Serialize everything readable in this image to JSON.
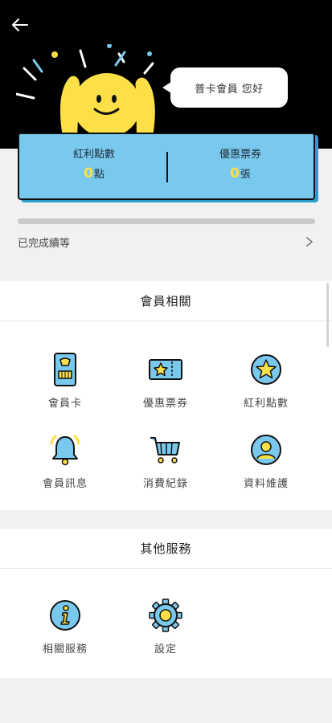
{
  "header": {
    "back_icon": "arrow-left-icon",
    "greeting": "普卡會員 您好"
  },
  "points": {
    "bonus_label": "紅利點數",
    "bonus_value": "0",
    "bonus_unit": "點",
    "coupon_label": "優惠票券",
    "coupon_value": "0",
    "coupon_unit": "張"
  },
  "level": {
    "text": "已完成續等",
    "progress": 0
  },
  "member_section": {
    "title": "會員相關",
    "items": [
      {
        "label": "會員卡",
        "icon": "member-card-icon"
      },
      {
        "label": "優惠票券",
        "icon": "ticket-icon"
      },
      {
        "label": "紅利點數",
        "icon": "star-coin-icon"
      },
      {
        "label": "會員訊息",
        "icon": "bell-icon"
      },
      {
        "label": "消費紀錄",
        "icon": "cart-icon"
      },
      {
        "label": "資料維護",
        "icon": "user-profile-icon"
      }
    ]
  },
  "other_section": {
    "title": "其他服務",
    "items": [
      {
        "label": "相關服務",
        "icon": "info-icon"
      },
      {
        "label": "設定",
        "icon": "gear-icon"
      }
    ]
  },
  "colors": {
    "accent_blue": "#79c9ee",
    "accent_yellow": "#fde047",
    "header_black": "#000000"
  }
}
